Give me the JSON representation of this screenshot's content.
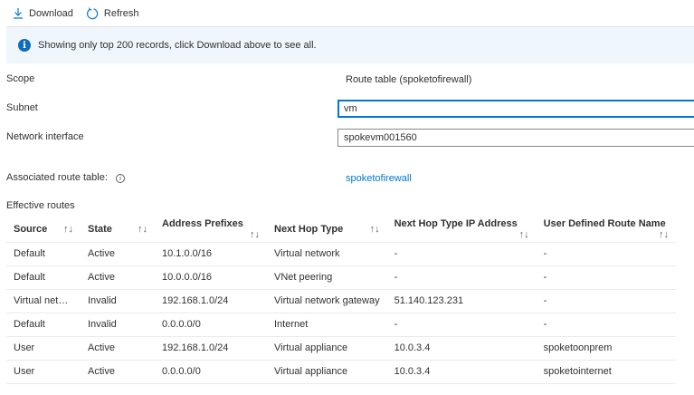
{
  "toolbar": {
    "download_label": "Download",
    "refresh_label": "Refresh"
  },
  "banner": {
    "message": "Showing only top 200 records, click Download above to see all."
  },
  "form": {
    "scope_label": "Scope",
    "scope_value": "Route table (spoketofirewall)",
    "subnet_label": "Subnet",
    "subnet_value": "vm",
    "nic_label": "Network interface",
    "nic_value": "spokevm001560",
    "assoc_label": "Associated route table:",
    "assoc_value": "spoketofirewall"
  },
  "routes": {
    "title": "Effective routes",
    "columns": [
      "Source",
      "State",
      "Address Prefixes",
      "Next Hop Type",
      "Next Hop Type IP Address",
      "User Defined Route Name"
    ],
    "rows": [
      [
        "Default",
        "Active",
        "10.1.0.0/16",
        "Virtual network",
        "-",
        "-"
      ],
      [
        "Default",
        "Active",
        "10.0.0.0/16",
        "VNet peering",
        "-",
        "-"
      ],
      [
        "Virtual network gateway",
        "Invalid",
        "192.168.1.0/24",
        "Virtual network gateway",
        "51.140.123.231",
        "-"
      ],
      [
        "Default",
        "Invalid",
        "0.0.0.0/0",
        "Internet",
        "-",
        "-"
      ],
      [
        "User",
        "Active",
        "192.168.1.0/24",
        "Virtual appliance",
        "10.0.3.4",
        "spoketoonprem"
      ],
      [
        "User",
        "Active",
        "0.0.0.0/0",
        "Virtual appliance",
        "10.0.3.4",
        "spoketointernet"
      ]
    ]
  },
  "colors": {
    "accent": "#0078d4",
    "banner_bg": "#eff6fc"
  }
}
